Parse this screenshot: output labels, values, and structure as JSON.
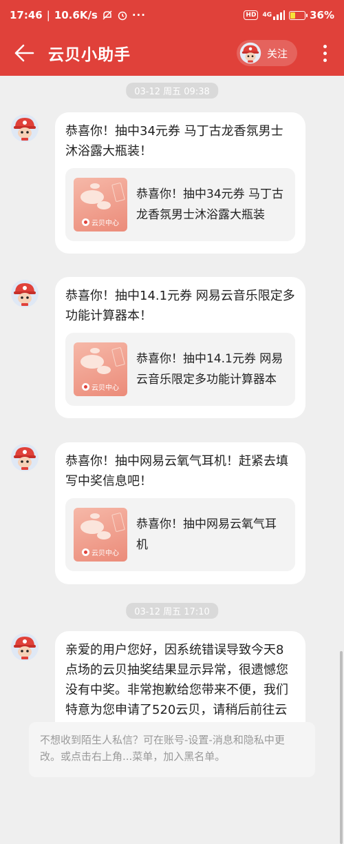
{
  "status_bar": {
    "time": "17:46",
    "net_speed": "10.6K/s",
    "signal": "4G",
    "hd": "HD",
    "battery_percent": "36%",
    "battery_level": 0.36
  },
  "header": {
    "title": "云贝小助手",
    "follow_label": "关注"
  },
  "chat": {
    "timestamps": [
      "03-12 周五 09:38",
      "03-12 周五 17:10"
    ],
    "messages": [
      {
        "text": "恭喜你！抽中34元券 马丁古龙香氛男士沐浴露大瓶装！",
        "card": {
          "thumb_label": "云贝中心",
          "text": "恭喜你！抽中34元券 马丁古龙香氛男士沐浴露大瓶装"
        }
      },
      {
        "text": "恭喜你！抽中14.1元券 网易云音乐限定多功能计算器本！",
        "card": {
          "thumb_label": "云贝中心",
          "text": "恭喜你！抽中14.1元券 网易云音乐限定多功能计算器本"
        }
      },
      {
        "text": "恭喜你！抽中网易云氧气耳机！赶紧去填写中奖信息吧！",
        "card": {
          "thumb_label": "云贝中心",
          "text": "恭喜你！抽中网易云氧气耳机"
        }
      },
      {
        "text": "亲爱的用户您好，因系统错误导致今天8点场的云贝抽奖结果显示异常，很遗憾您没有中奖。非常抱歉给您带来不便，我们特意为您申请了520云贝，请稍后前往云贝中心查看，供您后续参加活动，感谢您的理解！"
      }
    ],
    "notice": "不想收到陌生人私信？可在账号-设置-消息和隐私中更改。或点击右上角...菜单，加入黑名单。"
  },
  "colors": {
    "brand_red": "#e0413a",
    "bubble_bg": "#ffffff",
    "chat_bg": "#efefef"
  },
  "icons": [
    "back-arrow-icon",
    "more-vertical-icon",
    "bot-avatar-icon",
    "yunbei-logo-icon",
    "mute-icon",
    "alarm-icon"
  ]
}
